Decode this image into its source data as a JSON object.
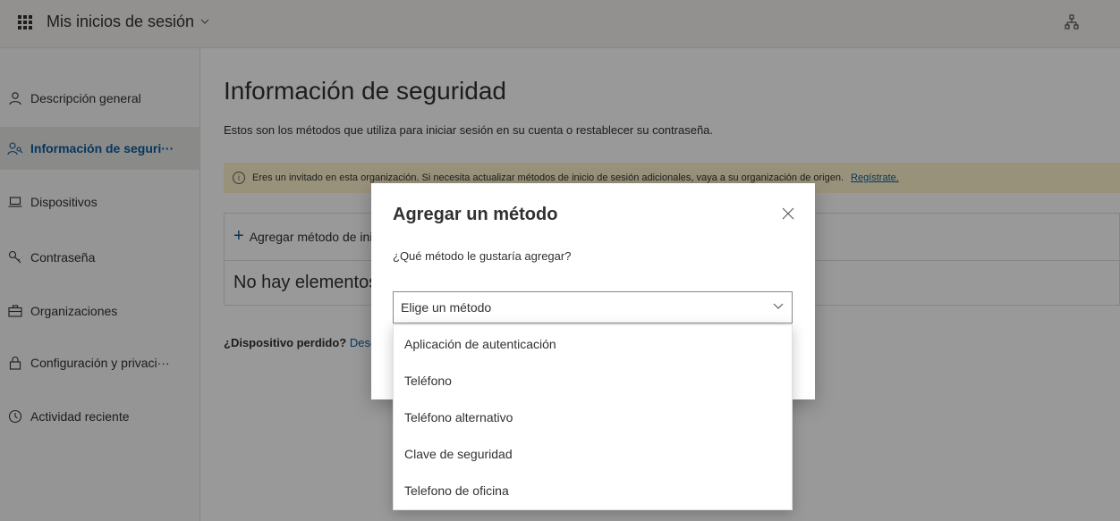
{
  "topbar": {
    "app_title": "Mis inicios de sesión",
    "icons": [
      "waffle-icon",
      "chevron-down-icon",
      "org-chart-icon"
    ]
  },
  "sidebar": {
    "items": [
      {
        "label": "Descripción general",
        "icon": "person-icon"
      },
      {
        "label": "Información de seguri···",
        "icon": "security-info-icon"
      },
      {
        "label": "Dispositivos",
        "icon": "laptop-icon"
      },
      {
        "label": "Contraseña",
        "icon": "key-icon"
      },
      {
        "label": "Organizaciones",
        "icon": "briefcase-icon"
      },
      {
        "label": "Configuración y privaci···",
        "icon": "lock-icon"
      },
      {
        "label": "Actividad reciente",
        "icon": "history-icon"
      }
    ],
    "active_index": 1
  },
  "main": {
    "title": "Información de seguridad",
    "subtitle": "Estos son los métodos que utiliza para iniciar sesión en su cuenta o restablecer su contraseña.",
    "info_bar": {
      "text": "Eres un invitado en esta organización. Si necesita actualizar métodos de inicio de sesión adicionales, vaya a su organización de origen.",
      "link": "Regístrate."
    },
    "add_method_label": "Agregar método de inicio de sesión",
    "empty_text": "No hay elementos para mostrar.",
    "lost_device_bold": "¿Dispositivo perdido?",
    "lost_device_link": "Desconectar todo"
  },
  "dialog": {
    "title": "Agregar un método",
    "question": "¿Qué método le gustaría agregar?",
    "select_value": "Elige un método",
    "options": [
      "Aplicación de autenticación",
      "Teléfono",
      "Teléfono alternativo",
      "Clave de seguridad",
      "Telefono de oficina"
    ]
  },
  "colors": {
    "accent": "#0b5a9d",
    "info_bar_bg": "#fff4ce",
    "sidebar_bg": "#f8f8f8"
  }
}
